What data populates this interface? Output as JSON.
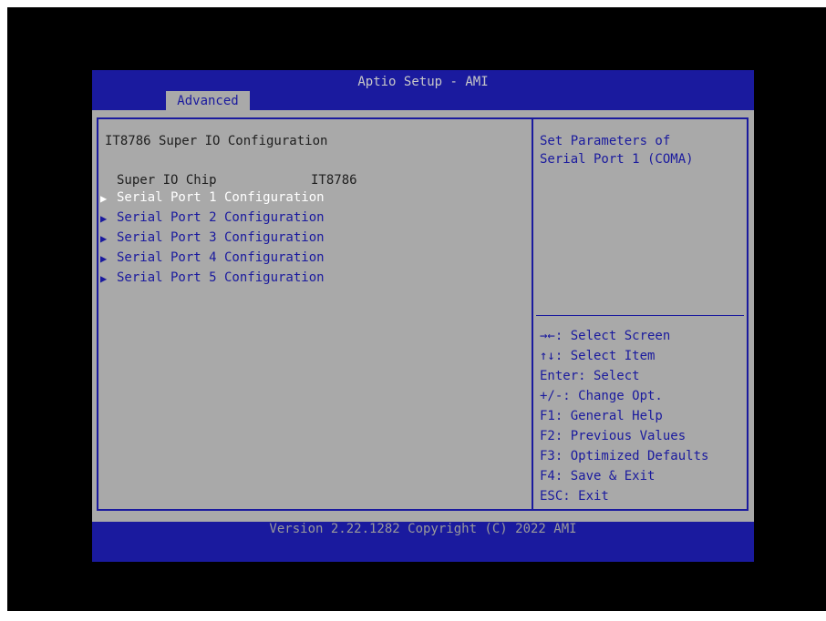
{
  "title": "Aptio Setup - AMI",
  "active_tab": "Advanced",
  "left": {
    "heading": "IT8786 Super IO Configuration",
    "chip_label": "Super IO Chip",
    "chip_value": "IT8786",
    "menu_items": [
      {
        "label": "Serial Port 1 Configuration",
        "selected": true
      },
      {
        "label": "Serial Port 2 Configuration",
        "selected": false
      },
      {
        "label": "Serial Port 3 Configuration",
        "selected": false
      },
      {
        "label": "Serial Port 4 Configuration",
        "selected": false
      },
      {
        "label": "Serial Port 5 Configuration",
        "selected": false
      }
    ],
    "arrow_icon": "triangle-right-icon"
  },
  "help": {
    "line1": "Set Parameters of",
    "line2": "Serial Port 1 (COMA)"
  },
  "keys": [
    "→←: Select Screen",
    "↑↓: Select Item",
    "Enter: Select",
    "+/-: Change Opt.",
    "F1: General Help",
    "F2: Previous Values",
    "F3: Optimized Defaults",
    "F4: Save & Exit",
    "ESC: Exit"
  ],
  "footer": "Version 2.22.1282 Copyright (C) 2022 AMI",
  "colors": {
    "bios_blue": "#1a1a9e",
    "panel_gray": "#a9a9a9",
    "selected_white": "#ffffff"
  }
}
